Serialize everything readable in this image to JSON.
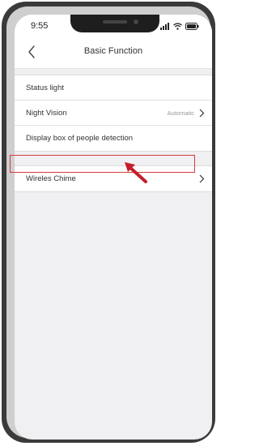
{
  "status_bar": {
    "time": "9:55"
  },
  "header": {
    "title": "Basic Function"
  },
  "settings": {
    "group1": [
      {
        "label": "Status light",
        "value": "",
        "chevron": false
      },
      {
        "label": "Night Vision",
        "value": "Automatic",
        "chevron": true
      },
      {
        "label": "Display box of people detection",
        "value": "",
        "chevron": false
      }
    ],
    "group2": [
      {
        "label": "Wireles  Chime",
        "value": "",
        "chevron": true
      }
    ]
  },
  "colors": {
    "highlight": "#d63a3a",
    "background": "#f0f0f2"
  },
  "icons": [
    "back-chevron-icon",
    "chevron-right-icon",
    "signal-icon",
    "wifi-icon",
    "battery-icon",
    "annotation-arrow-icon"
  ]
}
